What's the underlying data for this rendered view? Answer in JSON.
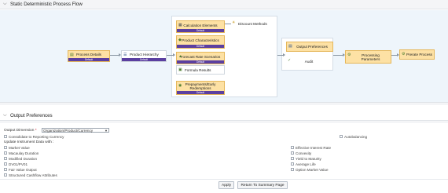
{
  "sections": {
    "flow_title": "Static Deterministic Process Flow",
    "output_title": "Output Preferences"
  },
  "flow": {
    "nodes": {
      "process_details": {
        "label": "Process Details",
        "badge": "Default"
      },
      "product_hierarchy": {
        "label": "Product Hierarchy",
        "badge": "Default"
      },
      "calculation_elements": {
        "label": "Calculation Elements",
        "badge": "Default"
      },
      "discount_methods": {
        "label": "Discount Methods"
      },
      "product_characteristics": {
        "label": "Product Characteristics",
        "badge": "Default"
      },
      "forecast_rate_scenarios": {
        "label": "Forecast Rate Scenarios",
        "badge": "Default"
      },
      "formula_results": {
        "label": "Formula Results"
      },
      "prepayments": {
        "label": "Prepayments/Early Redemptions",
        "badge": "Default"
      },
      "output_preferences": {
        "label": "Output Preferences"
      },
      "audit": {
        "label": "Audit"
      },
      "processing_parameters": {
        "label": "Processing Parameters"
      },
      "prerate_process": {
        "label": "Prerate Process"
      }
    }
  },
  "form": {
    "output_dimension_label": "Output Dimension",
    "output_dimension_value": "Organization/Product/Currency",
    "consolidate_label": "Consolidate to Reporting Currency",
    "consolidate_checked": false,
    "autobalancing_label": "Autobalancing",
    "autobalancing_checked": false,
    "update_heading": "Update Instrument Data with :",
    "left_options": [
      "Market Value",
      "Macaulay Duration",
      "Modified Duration",
      "DV01/PV01",
      "Fair Value Output",
      "Structured Cashflow Attributes"
    ],
    "right_options": [
      "Effective Interest Rate",
      "Convexity",
      "Yield to Maturity",
      "Average Life",
      "Option Market Value"
    ]
  },
  "buttons": {
    "apply": "Apply",
    "return": "Return To Summary Page"
  },
  "colors": {
    "node_fill": "#fde1a4",
    "node_badge": "#5b3fa0",
    "canvas_bg": "#eef5fb"
  }
}
